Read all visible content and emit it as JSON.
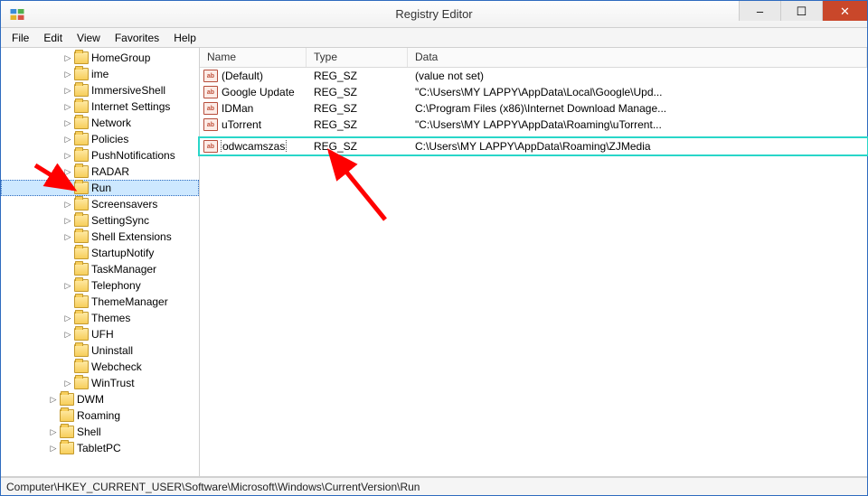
{
  "window": {
    "title": "Registry Editor",
    "controls": {
      "min": "–",
      "max": "☐",
      "close": "✕"
    }
  },
  "menu": [
    "File",
    "Edit",
    "View",
    "Favorites",
    "Help"
  ],
  "tree": [
    {
      "label": "HomeGroup",
      "indent": 4,
      "expander": "▷"
    },
    {
      "label": "ime",
      "indent": 4,
      "expander": "▷"
    },
    {
      "label": "ImmersiveShell",
      "indent": 4,
      "expander": "▷"
    },
    {
      "label": "Internet Settings",
      "indent": 4,
      "expander": "▷"
    },
    {
      "label": "Network",
      "indent": 4,
      "expander": "▷"
    },
    {
      "label": "Policies",
      "indent": 4,
      "expander": "▷"
    },
    {
      "label": "PushNotifications",
      "indent": 4,
      "expander": "▷"
    },
    {
      "label": "RADAR",
      "indent": 4,
      "expander": "▷"
    },
    {
      "label": "Run",
      "indent": 4,
      "expander": "",
      "selected": true
    },
    {
      "label": "Screensavers",
      "indent": 4,
      "expander": "▷"
    },
    {
      "label": "SettingSync",
      "indent": 4,
      "expander": "▷"
    },
    {
      "label": "Shell Extensions",
      "indent": 4,
      "expander": "▷"
    },
    {
      "label": "StartupNotify",
      "indent": 4,
      "expander": ""
    },
    {
      "label": "TaskManager",
      "indent": 4,
      "expander": ""
    },
    {
      "label": "Telephony",
      "indent": 4,
      "expander": "▷"
    },
    {
      "label": "ThemeManager",
      "indent": 4,
      "expander": ""
    },
    {
      "label": "Themes",
      "indent": 4,
      "expander": "▷"
    },
    {
      "label": "UFH",
      "indent": 4,
      "expander": "▷"
    },
    {
      "label": "Uninstall",
      "indent": 4,
      "expander": ""
    },
    {
      "label": "Webcheck",
      "indent": 4,
      "expander": ""
    },
    {
      "label": "WinTrust",
      "indent": 4,
      "expander": "▷"
    },
    {
      "label": "DWM",
      "indent": 3,
      "expander": "▷"
    },
    {
      "label": "Roaming",
      "indent": 3,
      "expander": ""
    },
    {
      "label": "Shell",
      "indent": 3,
      "expander": "▷"
    },
    {
      "label": "TabletPC",
      "indent": 3,
      "expander": "▷"
    }
  ],
  "list": {
    "columns": {
      "name": "Name",
      "type": "Type",
      "data": "Data"
    },
    "rows": [
      {
        "name": "(Default)",
        "type": "REG_SZ",
        "data": "(value not set)"
      },
      {
        "name": "Google Update",
        "type": "REG_SZ",
        "data": "\"C:\\Users\\MY LAPPY\\AppData\\Local\\Google\\Upd..."
      },
      {
        "name": "IDMan",
        "type": "REG_SZ",
        "data": "C:\\Program Files (x86)\\Internet Download Manage..."
      },
      {
        "name": "uTorrent",
        "type": "REG_SZ",
        "data": "\"C:\\Users\\MY LAPPY\\AppData\\Roaming\\uTorrent..."
      },
      {
        "name": "odwcamszas",
        "type": "REG_SZ",
        "data": "C:\\Users\\MY LAPPY\\AppData\\Roaming\\ZJMedia",
        "highlight": true
      }
    ]
  },
  "statusbar": "Computer\\HKEY_CURRENT_USER\\Software\\Microsoft\\Windows\\CurrentVersion\\Run",
  "annotations": {
    "arrow_color": "#ff0000"
  }
}
